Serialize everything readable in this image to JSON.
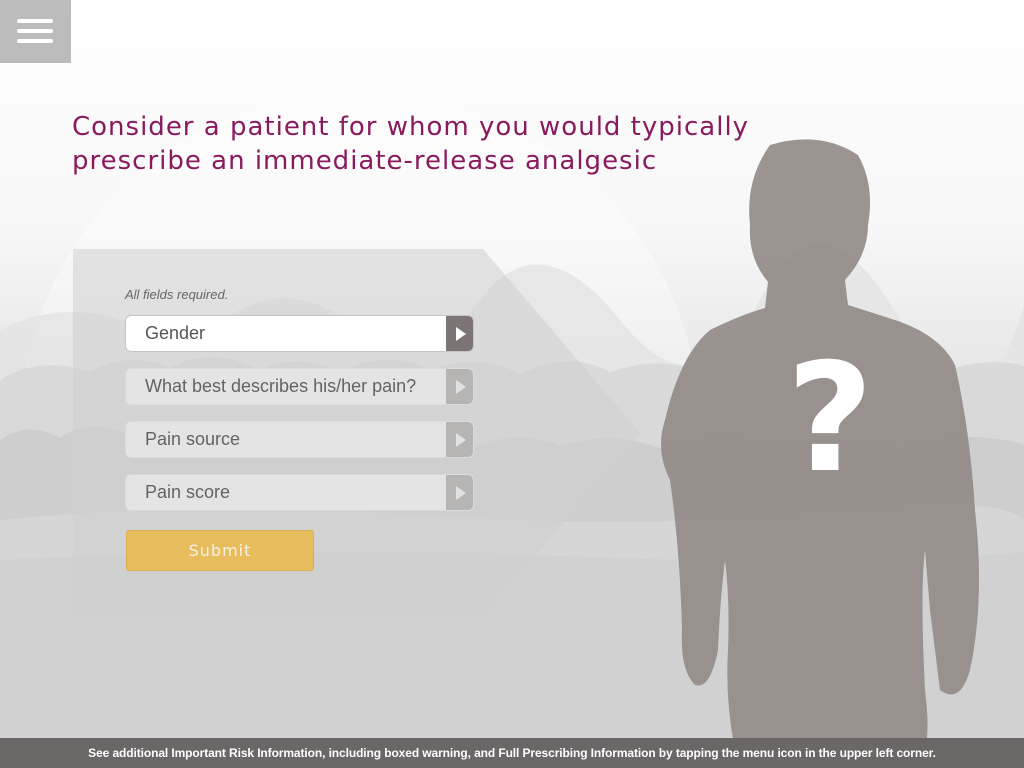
{
  "menu": {
    "icon": "hamburger-menu-icon"
  },
  "headline": {
    "line1": "Consider a patient for whom you would typically",
    "line2": "prescribe an immediate-release analgesic"
  },
  "form": {
    "required_note": "All fields required.",
    "fields": [
      {
        "label": "Gender",
        "state": "active"
      },
      {
        "label": "What best describes his/her pain?",
        "state": "disabled"
      },
      {
        "label": "Pain source",
        "state": "disabled"
      },
      {
        "label": "Pain score",
        "state": "disabled"
      }
    ],
    "submit_label": "Submit"
  },
  "illustration": {
    "question_mark": "?"
  },
  "footer": {
    "text": "See additional Important Risk Information, including boxed warning, and Full Prescribing Information by tapping the menu icon in the upper left corner."
  },
  "colors": {
    "headline": "#8a1a5e",
    "submit": "#e8bd5e",
    "footer_bg": "#6b6767",
    "silhouette": "#928b88"
  }
}
